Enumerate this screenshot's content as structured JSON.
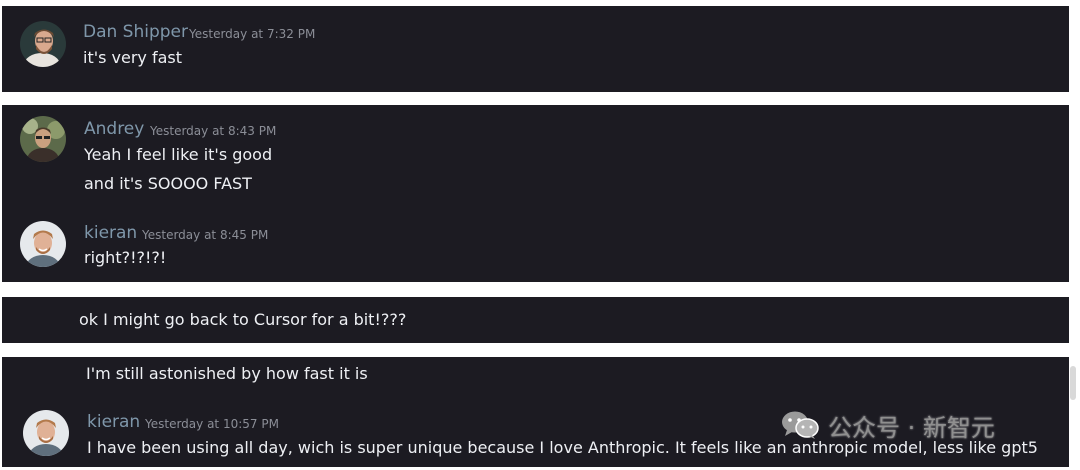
{
  "panels": [
    {
      "messages": [
        {
          "author": "Dan Shipper",
          "timestamp": "Yesterday at 7:32 PM",
          "lines": [
            "it's very fast"
          ]
        }
      ]
    },
    {
      "messages": [
        {
          "author": "Andrey",
          "timestamp": "Yesterday at 8:43 PM",
          "lines": [
            "Yeah I feel like it's good",
            "and it's SOOOO FAST"
          ]
        },
        {
          "author": "kieran",
          "timestamp": "Yesterday at 8:45 PM",
          "lines": [
            "right?!?!?!"
          ]
        }
      ]
    },
    {
      "messages": [
        {
          "lines": [
            "ok I might go back to Cursor for a bit!???"
          ]
        }
      ]
    },
    {
      "messages": [
        {
          "lines": [
            "I'm still astonished by how fast it is"
          ]
        },
        {
          "author": "kieran",
          "timestamp": "Yesterday at 10:57 PM",
          "lines": [
            "I have been using all day, wich is super unique because I love Anthropic. It feels like an anthropic model, less like gpt5"
          ]
        }
      ]
    }
  ],
  "watermark": {
    "text": "公众号 · 新智元",
    "icon": "wechat-icon"
  },
  "colors": {
    "panel_bg": "#1c1b22",
    "author": "#7f97aa",
    "timestamp": "#8b8e97",
    "message_text": "#eef0f4"
  }
}
